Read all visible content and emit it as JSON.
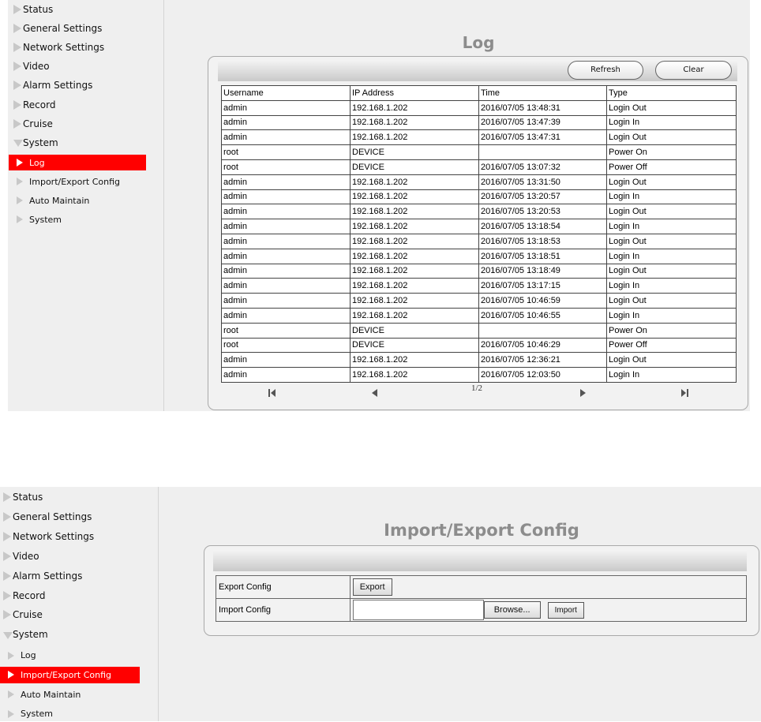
{
  "top": {
    "sidebar": {
      "items": [
        {
          "label": "Status"
        },
        {
          "label": "General Settings"
        },
        {
          "label": "Network Settings"
        },
        {
          "label": "Video"
        },
        {
          "label": "Alarm Settings"
        },
        {
          "label": "Record"
        },
        {
          "label": "Cruise"
        },
        {
          "label": "System"
        }
      ],
      "sub_items": [
        {
          "label": "Log",
          "active": true
        },
        {
          "label": "Import/Export Config",
          "active": false
        },
        {
          "label": "Auto Maintain",
          "active": false
        },
        {
          "label": "System",
          "active": false
        }
      ]
    },
    "title": "Log",
    "refresh_label": "Refresh",
    "clear_label": "Clear",
    "columns": [
      "Username",
      "IP Address",
      "Time",
      "Type"
    ],
    "rows": [
      [
        "admin",
        "192.168.1.202",
        "2016/07/05 13:48:31",
        "Login Out"
      ],
      [
        "admin",
        "192.168.1.202",
        "2016/07/05 13:47:39",
        "Login In"
      ],
      [
        "admin",
        "192.168.1.202",
        "2016/07/05 13:47:31",
        "Login Out"
      ],
      [
        "root",
        "DEVICE",
        "",
        "Power On"
      ],
      [
        "root",
        "DEVICE",
        "2016/07/05 13:07:32",
        "Power Off"
      ],
      [
        "admin",
        "192.168.1.202",
        "2016/07/05 13:31:50",
        "Login Out"
      ],
      [
        "admin",
        "192.168.1.202",
        "2016/07/05 13:20:57",
        "Login In"
      ],
      [
        "admin",
        "192.168.1.202",
        "2016/07/05 13:20:53",
        "Login Out"
      ],
      [
        "admin",
        "192.168.1.202",
        "2016/07/05 13:18:54",
        "Login In"
      ],
      [
        "admin",
        "192.168.1.202",
        "2016/07/05 13:18:53",
        "Login Out"
      ],
      [
        "admin",
        "192.168.1.202",
        "2016/07/05 13:18:51",
        "Login In"
      ],
      [
        "admin",
        "192.168.1.202",
        "2016/07/05 13:18:49",
        "Login Out"
      ],
      [
        "admin",
        "192.168.1.202",
        "2016/07/05 13:17:15",
        "Login In"
      ],
      [
        "admin",
        "192.168.1.202",
        "2016/07/05 10:46:59",
        "Login Out"
      ],
      [
        "admin",
        "192.168.1.202",
        "2016/07/05 10:46:55",
        "Login In"
      ],
      [
        "root",
        "DEVICE",
        "",
        "Power On"
      ],
      [
        "root",
        "DEVICE",
        "2016/07/05 10:46:29",
        "Power Off"
      ],
      [
        "admin",
        "192.168.1.202",
        "2016/07/05 12:36:21",
        "Login Out"
      ],
      [
        "admin",
        "192.168.1.202",
        "2016/07/05 12:03:50",
        "Login In"
      ]
    ],
    "page_indicator": "1/2"
  },
  "bottom": {
    "sidebar": {
      "items": [
        {
          "label": "Status"
        },
        {
          "label": "General Settings"
        },
        {
          "label": "Network Settings"
        },
        {
          "label": "Video"
        },
        {
          "label": "Alarm Settings"
        },
        {
          "label": "Record"
        },
        {
          "label": "Cruise"
        },
        {
          "label": "System"
        }
      ],
      "sub_items": [
        {
          "label": "Log",
          "active": false
        },
        {
          "label": "Import/Export Config",
          "active": true
        },
        {
          "label": "Auto Maintain",
          "active": false
        },
        {
          "label": "System",
          "active": false
        }
      ]
    },
    "title": "Import/Export Config",
    "export_row_label": "Export Config",
    "export_button": "Export",
    "import_row_label": "Import Config",
    "browse_button": "Browse...",
    "import_button": "Import"
  },
  "colors": {
    "active_nav": "#ff0000",
    "panel_bg": "#efefef",
    "title_gray": "#8c8c8c"
  }
}
